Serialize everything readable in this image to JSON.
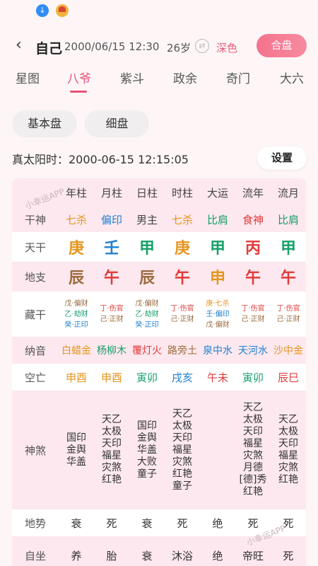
{
  "colors": {
    "red": "#e23b3b",
    "orange": "#e69520",
    "blue": "#1e7fcf",
    "green": "#15a06a",
    "brown": "#9b6a3e",
    "gray": "#444444",
    "pink": "#e45277"
  },
  "status": {
    "download_icon": "download-icon",
    "avatar_icon": "app-avatar-icon"
  },
  "header": {
    "back_icon": "back-chevron-icon",
    "name": "自己",
    "date": "2000/06/15 12:30",
    "age": "26岁",
    "swap_icon": "swap-icon",
    "theme": "深色",
    "action": "合盘"
  },
  "tabs": [
    {
      "label": "星图",
      "active": false
    },
    {
      "label": "八爷",
      "active": true
    },
    {
      "label": "紫斗",
      "active": false
    },
    {
      "label": "政余",
      "active": false
    },
    {
      "label": "奇门",
      "active": false
    },
    {
      "label": "大六",
      "active": false
    }
  ],
  "modes": {
    "basic": "基本盘",
    "detail": "细盘"
  },
  "solar_time": {
    "text": "真太阳时：2000-06-15 12:15:05",
    "button": "设置"
  },
  "watermark": "小幸运APP",
  "table": {
    "columns": [
      "年柱",
      "月柱",
      "日柱",
      "时柱",
      "大运",
      "流年",
      "流月"
    ],
    "rows": {
      "ten_god": {
        "label": "干神",
        "cells": [
          {
            "t": "七杀",
            "c": "orange"
          },
          {
            "t": "偏印",
            "c": "blue"
          },
          {
            "t": "男主",
            "c": "gray"
          },
          {
            "t": "七杀",
            "c": "orange"
          },
          {
            "t": "比肩",
            "c": "green"
          },
          {
            "t": "食神",
            "c": "red"
          },
          {
            "t": "比肩",
            "c": "green"
          }
        ]
      },
      "stem": {
        "label": "天干",
        "cells": [
          {
            "t": "庚",
            "c": "orange"
          },
          {
            "t": "壬",
            "c": "blue"
          },
          {
            "t": "甲",
            "c": "green"
          },
          {
            "t": "庚",
            "c": "orange"
          },
          {
            "t": "甲",
            "c": "green"
          },
          {
            "t": "丙",
            "c": "red"
          },
          {
            "t": "甲",
            "c": "green"
          }
        ]
      },
      "branch": {
        "label": "地支",
        "cells": [
          {
            "t": "辰",
            "c": "brown"
          },
          {
            "t": "午",
            "c": "red"
          },
          {
            "t": "辰",
            "c": "brown"
          },
          {
            "t": "午",
            "c": "red"
          },
          {
            "t": "申",
            "c": "orange"
          },
          {
            "t": "午",
            "c": "red"
          },
          {
            "t": "午",
            "c": "red"
          }
        ]
      },
      "hidden": {
        "label": "藏干",
        "cells": [
          [
            {
              "t": "戊·偏财",
              "c": "brown"
            },
            {
              "t": "乙·劫财",
              "c": "green"
            },
            {
              "t": "癸·正印",
              "c": "blue"
            }
          ],
          [
            {
              "t": "丁·伤官",
              "c": "red"
            },
            {
              "t": "己·正财",
              "c": "brown"
            }
          ],
          [
            {
              "t": "戊·偏财",
              "c": "brown"
            },
            {
              "t": "乙·劫财",
              "c": "green"
            },
            {
              "t": "癸·正印",
              "c": "blue"
            }
          ],
          [
            {
              "t": "丁·伤官",
              "c": "red"
            },
            {
              "t": "己·正财",
              "c": "brown"
            }
          ],
          [
            {
              "t": "庚·七杀",
              "c": "orange"
            },
            {
              "t": "壬·偏印",
              "c": "blue"
            },
            {
              "t": "戊·偏财",
              "c": "brown"
            }
          ],
          [
            {
              "t": "丁·伤官",
              "c": "red"
            },
            {
              "t": "己·正财",
              "c": "brown"
            }
          ],
          [
            {
              "t": "丁·伤官",
              "c": "red"
            },
            {
              "t": "己·正财",
              "c": "brown"
            }
          ]
        ]
      },
      "nayin": {
        "label": "纳音",
        "cells": [
          {
            "t": "白蜡金",
            "c": "orange"
          },
          {
            "t": "杨柳木",
            "c": "green"
          },
          {
            "t": "覆灯火",
            "c": "red"
          },
          {
            "t": "路旁土",
            "c": "brown"
          },
          {
            "t": "泉中水",
            "c": "blue"
          },
          {
            "t": "天河水",
            "c": "blue"
          },
          {
            "t": "沙中金",
            "c": "orange"
          }
        ]
      },
      "void": {
        "label": "空亡",
        "cells": [
          {
            "t": "申酉",
            "c": "orange"
          },
          {
            "t": "申酉",
            "c": "orange"
          },
          {
            "t": "寅卯",
            "c": "green"
          },
          {
            "t": "戌亥",
            "c": "blue"
          },
          {
            "t": "午未",
            "c": "red"
          },
          {
            "t": "寅卯",
            "c": "green"
          },
          {
            "t": "辰巳",
            "c": "red"
          }
        ]
      },
      "stars": {
        "label": "神煞",
        "cells": [
          [
            "国印",
            "金舆",
            "华盖"
          ],
          [
            "天乙",
            "太极",
            "天印",
            "福星",
            "灾煞",
            "红艳"
          ],
          [
            "国印",
            "金舆",
            "华盖",
            "大败",
            "童子"
          ],
          [
            "天乙",
            "太极",
            "天印",
            "福星",
            "灾煞",
            "红艳",
            "童子"
          ],
          [],
          [
            "天乙",
            "太极",
            "天印",
            "福星",
            "灾煞",
            "月德",
            "[德]秀",
            "红艳"
          ],
          [
            "天乙",
            "太极",
            "天印",
            "福星",
            "灾煞",
            "红艳"
          ]
        ]
      },
      "terrain": {
        "label": "地势",
        "cells": [
          "衰",
          "死",
          "衰",
          "死",
          "绝",
          "死",
          "死"
        ]
      },
      "self_seat": {
        "label": "自坐",
        "cells": [
          "养",
          "胎",
          "衰",
          "沐浴",
          "绝",
          "帝旺",
          "死"
        ]
      }
    }
  }
}
